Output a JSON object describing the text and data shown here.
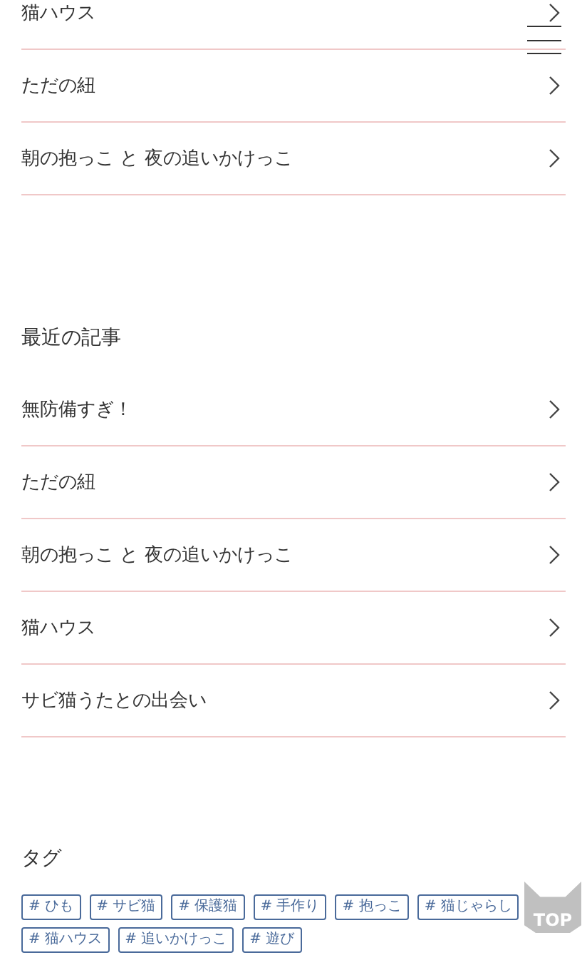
{
  "menu_button": {
    "kind": "hamburger"
  },
  "top_list": [
    {
      "title": "猫ハウス"
    },
    {
      "title": "ただの紐"
    },
    {
      "title": "朝の抱っこ と 夜の追いかけっこ"
    }
  ],
  "recent": {
    "heading": "最近の記事",
    "items": [
      {
        "title": "無防備すぎ！"
      },
      {
        "title": "ただの紐"
      },
      {
        "title": "朝の抱っこ と 夜の追いかけっこ"
      },
      {
        "title": "猫ハウス"
      },
      {
        "title": "サビ猫うたとの出会い"
      }
    ]
  },
  "tags": {
    "heading": "タグ",
    "items": [
      "# ひも",
      "# サビ猫",
      "# 保護猫",
      "# 手作り",
      "# 抱っこ",
      "# 猫じゃらし",
      "# 猫ハウス",
      "# 追いかけっこ",
      "# 遊び"
    ]
  },
  "top_button": {
    "label": "TOP"
  }
}
